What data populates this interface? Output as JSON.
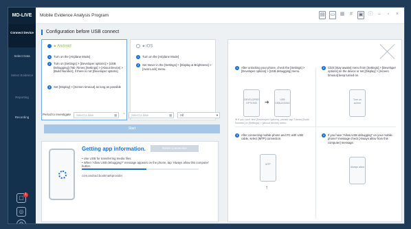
{
  "app": {
    "brand": "MD-LIVE",
    "title": "Mobile Evidence Analysis Program"
  },
  "toolbar": {
    "icons": [
      "report-icon",
      "monitor-icon",
      "grid-icon",
      "hash-icon",
      "image-icon",
      "info-icon",
      "minimize-icon",
      "restore-icon",
      "close-icon"
    ]
  },
  "sidebar": {
    "items": [
      {
        "label": "Connect Device"
      },
      {
        "label": "Select Data"
      },
      {
        "label": "Select Evidence"
      },
      {
        "label": "Reporting"
      },
      {
        "label": "Recording"
      }
    ],
    "badge": "1"
  },
  "section_title": "Configuration before USB connect",
  "android": {
    "label": "Android",
    "steps": [
      "Turn on the [Airplane Mode]",
      "Turn on [Settings] > [Developer options] > [USB Debugging] (Tab 7times [Settings] > [About Device] > [Build Number], if there is not [Developer options]",
      "Set [Display] > [Screen timeout] as long as possible"
    ]
  },
  "ios": {
    "label": "iOS",
    "steps": [
      "Turn on the [Airplane Mode]",
      "Set Never in the [Settings] > [Display & Brightness] > [Auto Lock] menu."
    ]
  },
  "period": {
    "label": "Period to Investigate",
    "from_placeholder": "Select a date",
    "to_placeholder": "Select a date",
    "tilde": "~",
    "filter": "All"
  },
  "start_label": "Start",
  "getting": {
    "title": "Getting app information.",
    "reset": "Reset Connection",
    "info": [
      "Use USB for transferring media files.",
      "When 'Allow USB debugging?' message appears on the phone, tap 'Always allow this computer' button."
    ],
    "package": "com.android.bookmarkprovider",
    "progress": 0.55
  },
  "guide": {
    "steps": [
      "After unlocking your phone, check the [Settings] > [Developer options] > [USB debugging] menu.",
      "Click [Stay awake] menu from [Settings] > [Developer options] on the device or set [Display] > [Screen timeout] keep turned on.",
      "After connecting mobile phone and PC with USB cable, select [MTP] connection.",
      "If you have \"Allow USB debugging\" on your mobile phone? message check [Always allow from this computer] message."
    ],
    "note": "※ If you can't find [Developer Options], please tap 7 times [Build Number] in [Settings] > [About device] menu.",
    "phone_labels": [
      "DEVELOPER OPTIONS",
      "USB DEBUGGING",
      "Turn on screen",
      "MTP",
      "Always allow"
    ]
  }
}
